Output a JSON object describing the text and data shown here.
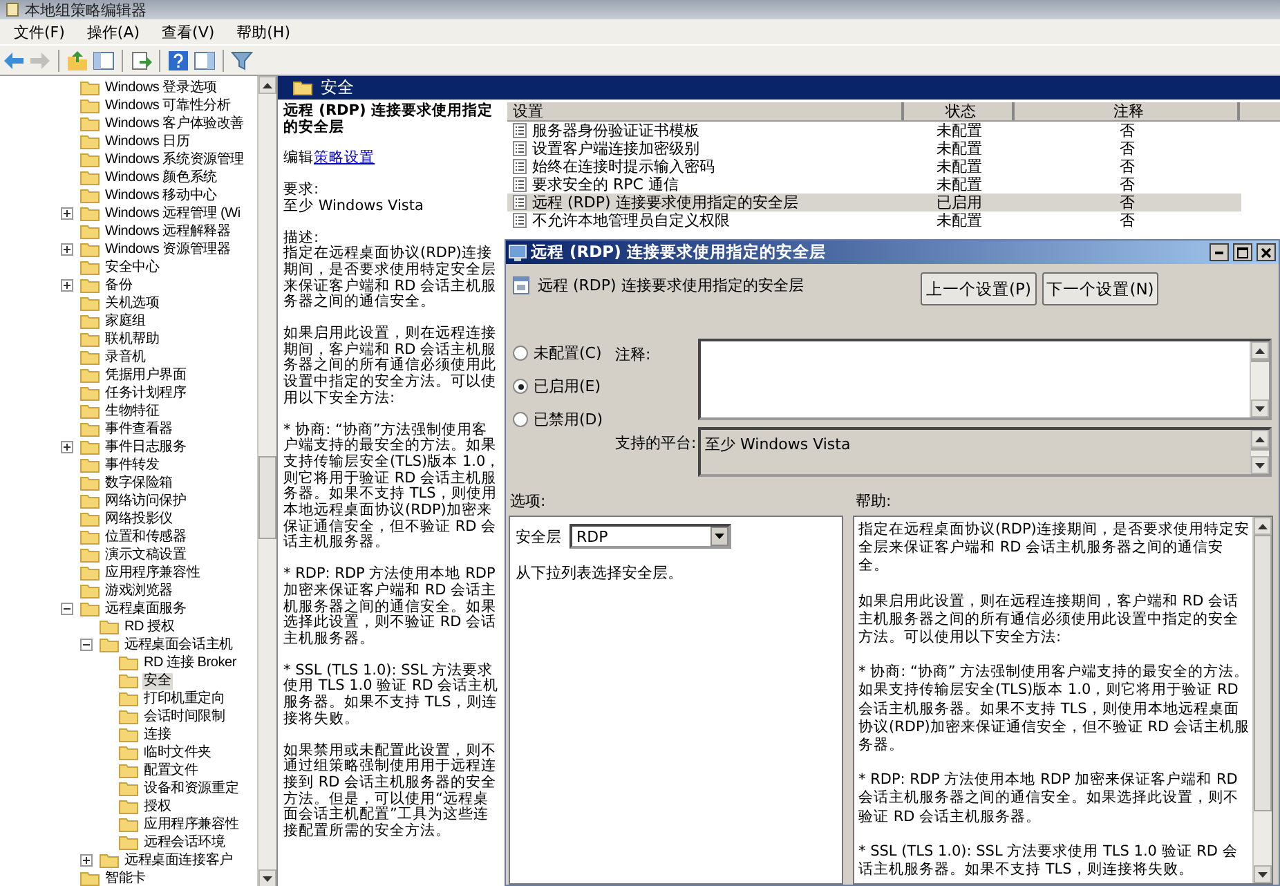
{
  "window": {
    "title": "本地组策略编辑器"
  },
  "menu": [
    "文件(F)",
    "操作(A)",
    "查看(V)",
    "帮助(H)"
  ],
  "toolbar": [
    {
      "kind": "back",
      "disabled": false
    },
    {
      "kind": "forward",
      "disabled": true
    },
    {
      "kind": "sep"
    },
    {
      "kind": "up",
      "disabled": false
    },
    {
      "kind": "tree",
      "disabled": false
    },
    {
      "kind": "sep"
    },
    {
      "kind": "export",
      "disabled": false
    },
    {
      "kind": "sep"
    },
    {
      "kind": "help",
      "disabled": false
    },
    {
      "kind": "pane",
      "disabled": false
    },
    {
      "kind": "sep"
    },
    {
      "kind": "filter",
      "disabled": false
    }
  ],
  "tree": {
    "items": [
      {
        "label": "Windows 登录选项",
        "kind": "leaf",
        "selected": false
      },
      {
        "label": "Windows 可靠性分析",
        "kind": "leaf",
        "selected": false
      },
      {
        "label": "Windows 客户体验改善",
        "kind": "leaf",
        "selected": false
      },
      {
        "label": "Windows 日历",
        "kind": "leaf",
        "selected": false
      },
      {
        "label": "Windows 系统资源管理",
        "kind": "leaf",
        "selected": false
      },
      {
        "label": "Windows 颜色系统",
        "kind": "leaf",
        "selected": false
      },
      {
        "label": "Windows 移动中心",
        "kind": "leaf",
        "selected": false
      },
      {
        "label": "Windows 远程管理 (Wi",
        "kind": "collapsed",
        "selected": false
      },
      {
        "label": "Windows 远程解释器",
        "kind": "leaf",
        "selected": false
      },
      {
        "label": "Windows 资源管理器",
        "kind": "collapsed",
        "selected": false
      },
      {
        "label": "安全中心",
        "kind": "leaf",
        "selected": false
      },
      {
        "label": "备份",
        "kind": "collapsed",
        "selected": false
      },
      {
        "label": "关机选项",
        "kind": "leaf",
        "selected": false
      },
      {
        "label": "家庭组",
        "kind": "leaf",
        "selected": false
      },
      {
        "label": "联机帮助",
        "kind": "leaf",
        "selected": false
      },
      {
        "label": "录音机",
        "kind": "leaf",
        "selected": false
      },
      {
        "label": "凭据用户界面",
        "kind": "leaf",
        "selected": false
      },
      {
        "label": "任务计划程序",
        "kind": "leaf",
        "selected": false
      },
      {
        "label": "生物特征",
        "kind": "leaf",
        "selected": false
      },
      {
        "label": "事件查看器",
        "kind": "leaf",
        "selected": false
      },
      {
        "label": "事件日志服务",
        "kind": "collapsed",
        "selected": false
      },
      {
        "label": "事件转发",
        "kind": "leaf",
        "selected": false
      },
      {
        "label": "数字保险箱",
        "kind": "leaf",
        "selected": false
      },
      {
        "label": "网络访问保护",
        "kind": "leaf",
        "selected": false
      },
      {
        "label": "网络投影仪",
        "kind": "leaf",
        "selected": false
      },
      {
        "label": "位置和传感器",
        "kind": "leaf",
        "selected": false
      },
      {
        "label": "演示文稿设置",
        "kind": "leaf",
        "selected": false
      },
      {
        "label": "应用程序兼容性",
        "kind": "leaf",
        "selected": false
      },
      {
        "label": "游戏浏览器",
        "kind": "leaf",
        "selected": false
      },
      {
        "label": "远程桌面服务",
        "kind": "expanded",
        "selected": false,
        "children": [
          {
            "label": "RD 授权",
            "kind": "leaf",
            "selected": false
          },
          {
            "label": "远程桌面会话主机",
            "kind": "expanded",
            "selected": false,
            "children": [
              {
                "label": "RD 连接 Broker",
                "kind": "leaf",
                "selected": false
              },
              {
                "label": "安全",
                "kind": "leaf",
                "selected": true
              },
              {
                "label": "打印机重定向",
                "kind": "leaf",
                "selected": false
              },
              {
                "label": "会话时间限制",
                "kind": "leaf",
                "selected": false
              },
              {
                "label": "连接",
                "kind": "leaf",
                "selected": false
              },
              {
                "label": "临时文件夹",
                "kind": "leaf",
                "selected": false
              },
              {
                "label": "配置文件",
                "kind": "leaf",
                "selected": false
              },
              {
                "label": "设备和资源重定",
                "kind": "leaf",
                "selected": false
              },
              {
                "label": "授权",
                "kind": "leaf",
                "selected": false
              },
              {
                "label": "应用程序兼容性",
                "kind": "leaf",
                "selected": false
              },
              {
                "label": "远程会话环境",
                "kind": "leaf",
                "selected": false
              }
            ]
          },
          {
            "label": "远程桌面连接客户",
            "kind": "collapsed",
            "selected": false
          }
        ]
      },
      {
        "label": "智能卡",
        "kind": "leaf",
        "selected": false
      }
    ]
  },
  "folder_header": "安全",
  "details": {
    "title": "远程 (RDP) 连接要求使用指定的安全层",
    "edit_label": "编辑",
    "edit_link": "策略设置",
    "requirements_label": "要求:",
    "requirements": "至少 Windows Vista",
    "description_label": "描述:",
    "paragraphs": [
      "指定在远程桌面协议(RDP)连接期间，是否要求使用特定安全层来保证客户端和 RD 会话主机服务器之间的通信安全。",
      "如果启用此设置，则在远程连接期间，客户端和 RD 会话主机服务器之间的所有通信必须使用此设置中指定的安全方法。可以使用以下安全方法:",
      "* 协商: “协商”方法强制使用客户端支持的最安全的方法。如果支持传输层安全(TLS)版本 1.0，则它将用于验证 RD 会话主机服务器。如果不支持 TLS，则使用本地远程桌面协议(RDP)加密来保证通信安全，但不验证 RD 会话主机服务器。",
      "* RDP: RDP 方法使用本地 RDP 加密来保证客户端和 RD 会话主机服务器之间的通信安全。如果选择此设置，则不验证 RD 会话主机服务器。",
      "* SSL (TLS 1.0): SSL 方法要求使用 TLS 1.0 验证 RD 会话主机服务器。如果不支持 TLS，则连接将失败。",
      "如果禁用或未配置此设置，则不通过组策略强制使用用于远程连接到 RD 会话主机服务器的安全方法。但是，可以使用“远程桌面会话主机配置”工具为这些连接配置所需的安全方法。"
    ]
  },
  "table": {
    "columns": [
      "设置",
      "状态",
      "注释"
    ],
    "rows": [
      {
        "setting": "服务器身份验证证书模板",
        "state": "未配置",
        "comment": "否",
        "selected": false
      },
      {
        "setting": "设置客户端连接加密级别",
        "state": "未配置",
        "comment": "否",
        "selected": false
      },
      {
        "setting": "始终在连接时提示输入密码",
        "state": "未配置",
        "comment": "否",
        "selected": false
      },
      {
        "setting": "要求安全的 RPC 通信",
        "state": "未配置",
        "comment": "否",
        "selected": false
      },
      {
        "setting": "远程 (RDP) 连接要求使用指定的安全层",
        "state": "已启用",
        "comment": "否",
        "selected": true
      },
      {
        "setting": "不允许本地管理员自定义权限",
        "state": "未配置",
        "comment": "否",
        "selected": false
      }
    ]
  },
  "dialog": {
    "title": "远程 (RDP) 连接要求使用指定的安全层",
    "heading": "远程 (RDP) 连接要求使用指定的安全层",
    "buttons": [
      "上一个设置(P)",
      "下一个设置(N)"
    ],
    "radios": [
      {
        "label": "未配置(C)",
        "selected": false
      },
      {
        "label": "已启用(E)",
        "selected": true
      },
      {
        "label": "已禁用(D)",
        "selected": false
      }
    ],
    "comment_label": "注释:",
    "platform_label": "支持的平台:",
    "platform": "至少 Windows Vista",
    "options_label": "选项:",
    "help_label": "帮助:",
    "option": {
      "label": "安全层",
      "value": "RDP",
      "hint": "从下拉列表选择安全层。"
    },
    "help": [
      "指定在远程桌面协议(RDP)连接期间，是否要求使用特定安全层来保证客户端和 RD 会话主机服务器之间的通信安全。",
      "如果启用此设置，则在远程连接期间，客户端和 RD 会话主机服务器之间的所有通信必须使用此设置中指定的安全方法。可以使用以下安全方法:",
      "* 协商: “协商” 方法强制使用客户端支持的最安全的方法。如果支持传输层安全(TLS)版本 1.0，则它将用于验证 RD 会话主机服务器。如果不支持 TLS，则使用本地远程桌面协议(RDP)加密来保证通信安全，但不验证 RD 会话主机服务器。",
      "* RDP: RDP 方法使用本地 RDP 加密来保证客户端和 RD 会话主机服务器之间的通信安全。如果选择此设置，则不验证 RD 会话主机服务器。",
      "* SSL (TLS 1.0): SSL 方法要求使用 TLS 1.0 验证 RD 会话主机服务器。如果不支持 TLS，则连接将失败。"
    ]
  }
}
